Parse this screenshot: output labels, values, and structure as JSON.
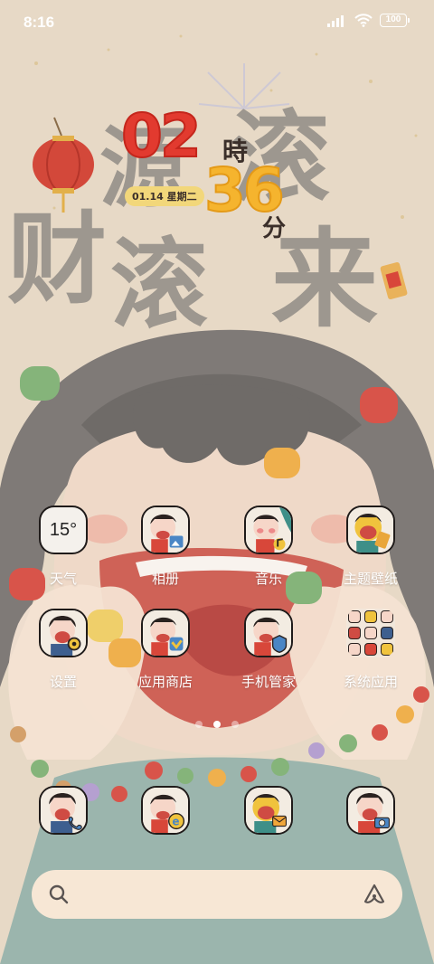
{
  "status_bar": {
    "time": "8:16",
    "battery": "100"
  },
  "clock": {
    "hour": "02",
    "hour_unit": "時",
    "minute": "36",
    "minute_unit": "分",
    "date": "01.14 星期二"
  },
  "wallpaper": {
    "characters": [
      "源",
      "滚",
      "财",
      "滚",
      "来"
    ]
  },
  "apps": [
    {
      "label": "天气",
      "icon": "weather-icon",
      "value": "15°"
    },
    {
      "label": "相册",
      "icon": "gallery-icon"
    },
    {
      "label": "音乐",
      "icon": "music-icon"
    },
    {
      "label": "主题壁纸",
      "icon": "themes-icon"
    },
    {
      "label": "设置",
      "icon": "settings-icon"
    },
    {
      "label": "应用商店",
      "icon": "app-store-icon"
    },
    {
      "label": "手机管家",
      "icon": "security-icon"
    },
    {
      "label": "系统应用",
      "icon": "system-apps-folder-icon"
    }
  ],
  "dock": [
    {
      "icon": "phone-icon"
    },
    {
      "icon": "browser-icon"
    },
    {
      "icon": "messages-icon"
    },
    {
      "icon": "camera-icon"
    }
  ],
  "pages": {
    "count": 3,
    "active": 2
  },
  "search": {
    "placeholder": ""
  },
  "colors": {
    "hour": "#e23a2f",
    "minute": "#f5b42e",
    "date_badge": "#f2d77a",
    "search_bg": "#fae8d6"
  }
}
